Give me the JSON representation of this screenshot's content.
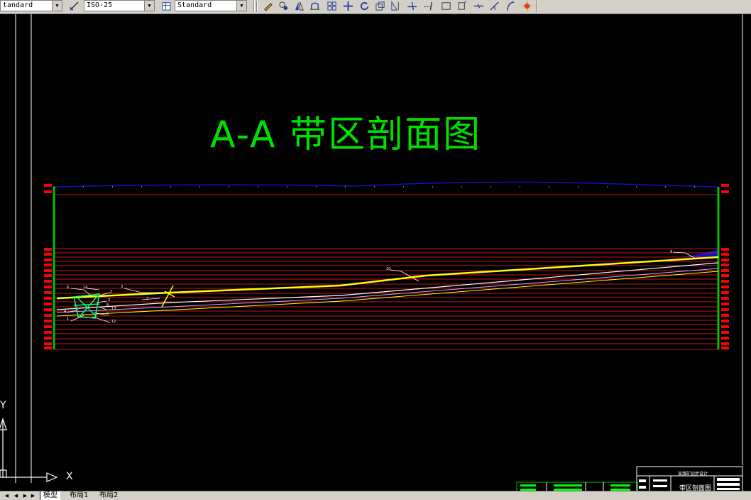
{
  "toolbar": {
    "text_style": "tandard",
    "dim_style": "ISO-25",
    "table_style": "Standard",
    "icons": [
      "pencil-icon",
      "hatch-icon",
      "mirror-icon",
      "offset-icon",
      "array-icon",
      "move-icon",
      "rotate-icon",
      "scale-icon",
      "stretch-icon",
      "trim-icon",
      "extend-icon",
      "break-icon",
      "join-icon",
      "chamfer-icon",
      "fillet-icon",
      "explode-icon"
    ]
  },
  "drawing": {
    "title": "A-A  带区剖面图",
    "labels": [
      "10",
      "9",
      "3",
      "2",
      "14",
      "3",
      "7",
      "13",
      "5",
      "4",
      "1",
      "12",
      "6",
      "8"
    ]
  },
  "title_block": {
    "project": "某煤矿初步设计",
    "drawing_name": "带区剖面图"
  },
  "ucs": {
    "x_label": "X",
    "y_label": "Y"
  },
  "tabs": {
    "model": "模型",
    "layout1": "布局1",
    "layout2": "布局2"
  },
  "colors": {
    "title": "#00e000",
    "strata": "#ff2020",
    "seam": "#ffff00",
    "terrain": "#1010c0",
    "frame": "#00c000"
  }
}
